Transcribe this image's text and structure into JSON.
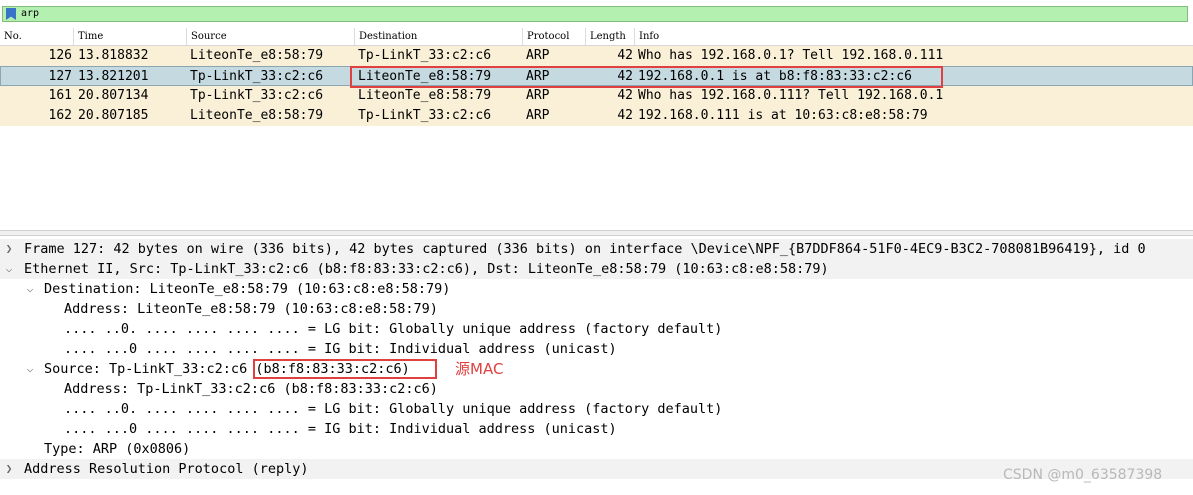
{
  "filter": {
    "text": "arp"
  },
  "columns": [
    "No.",
    "Time",
    "Source",
    "Destination",
    "Protocol",
    "Length",
    "Info"
  ],
  "packets": [
    {
      "no": "126",
      "time": "13.818832",
      "source": "LiteonTe_e8:58:79",
      "destination": "Tp-LinkT_33:c2:c6",
      "protocol": "ARP",
      "length": "42",
      "info": "Who has 192.168.0.1? Tell 192.168.0.111"
    },
    {
      "no": "127",
      "time": "13.821201",
      "source": "Tp-LinkT_33:c2:c6",
      "destination": "LiteonTe_e8:58:79",
      "protocol": "ARP",
      "length": "42",
      "info": "192.168.0.1 is at b8:f8:83:33:c2:c6"
    },
    {
      "no": "161",
      "time": "20.807134",
      "source": "Tp-LinkT_33:c2:c6",
      "destination": "LiteonTe_e8:58:79",
      "protocol": "ARP",
      "length": "42",
      "info": "Who has 192.168.0.111? Tell 192.168.0.1"
    },
    {
      "no": "162",
      "time": "20.807185",
      "source": "LiteonTe_e8:58:79",
      "destination": "Tp-LinkT_33:c2:c6",
      "protocol": "ARP",
      "length": "42",
      "info": "192.168.0.111 is at 10:63:c8:e8:58:79"
    }
  ],
  "details": [
    {
      "text": "Frame 127: 42 bytes on wire (336 bits), 42 bytes captured (336 bits) on interface \\Device\\NPF_{B7DDF864-51F0-4EC9-B3C2-708081B96419}, id 0",
      "arrow": ">"
    },
    {
      "text": "Ethernet II, Src: Tp-LinkT_33:c2:c6 (b8:f8:83:33:c2:c6), Dst: LiteonTe_e8:58:79 (10:63:c8:e8:58:79)",
      "arrow": "v"
    },
    {
      "text": "Destination: LiteonTe_e8:58:79 (10:63:c8:e8:58:79)",
      "arrow": "v"
    },
    {
      "text": "Address: LiteonTe_e8:58:79 (10:63:c8:e8:58:79)",
      "arrow": ""
    },
    {
      "text": ".... ..0. .... .... .... .... = LG bit: Globally unique address (factory default)",
      "arrow": ""
    },
    {
      "text": ".... ...0 .... .... .... .... = IG bit: Individual address (unicast)",
      "arrow": ""
    },
    {
      "text": "Source: Tp-LinkT_33:c2:c6 (b8:f8:83:33:c2:c6)",
      "arrow": "v"
    },
    {
      "text": "Address: Tp-LinkT_33:c2:c6 (b8:f8:83:33:c2:c6)",
      "arrow": ""
    },
    {
      "text": ".... ..0. .... .... .... .... = LG bit: Globally unique address (factory default)",
      "arrow": ""
    },
    {
      "text": ".... ...0 .... .... .... .... = IG bit: Individual address (unicast)",
      "arrow": ""
    },
    {
      "text": "Type: ARP (0x0806)",
      "arrow": ""
    },
    {
      "text": "Address Resolution Protocol (reply)",
      "arrow": ">"
    }
  ],
  "annotation": {
    "label": "源MAC"
  },
  "watermark": "CSDN @m0_63587398",
  "colors": {
    "arp_row": "#faf0d7",
    "selected_row": "#c5d9e0",
    "filter_bg": "#b4f0b0",
    "annotation": "#e04040"
  }
}
